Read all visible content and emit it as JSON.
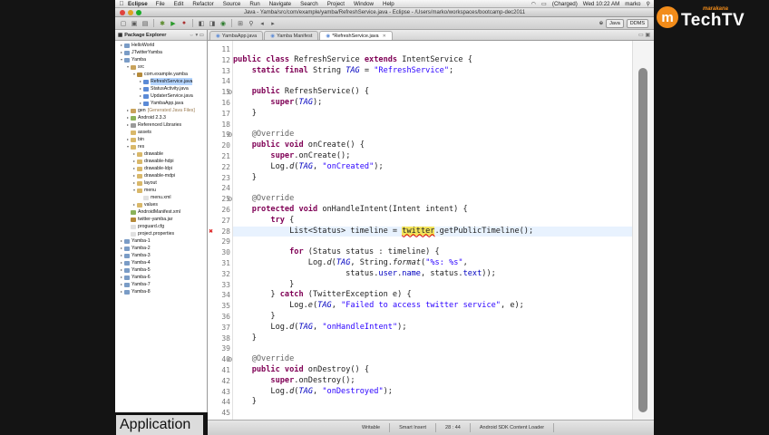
{
  "menubar": {
    "app": "Eclipse",
    "items": [
      "File",
      "Edit",
      "Refactor",
      "Source",
      "Run",
      "Navigate",
      "Search",
      "Project",
      "Window",
      "Help"
    ],
    "battery": "(Charged)",
    "clock": "Wed 10:22 AM",
    "user": "marko"
  },
  "window": {
    "title": "Java - Yamba/src/com/example/yamba/RefreshService.java - Eclipse - /Users/marko/workspaces/bootcamp-dec2011"
  },
  "toolbar": {
    "perspectives": [
      "Java",
      "DDMS"
    ]
  },
  "explorer": {
    "title": "Package Explorer",
    "nodes": [
      {
        "label": "HelloWorld",
        "depth": 0,
        "twisty": "▸",
        "color": "#7a9cc6"
      },
      {
        "label": "JTwitterYamba",
        "depth": 0,
        "twisty": "▸",
        "color": "#7a9cc6"
      },
      {
        "label": "Yamba",
        "depth": 0,
        "twisty": "▾",
        "color": "#7a9cc6"
      },
      {
        "label": "src",
        "depth": 1,
        "twisty": "▾",
        "color": "#c9a35c"
      },
      {
        "label": "com.example.yamba",
        "depth": 2,
        "twisty": "▾",
        "color": "#b58a3a"
      },
      {
        "label": "RefreshService.java",
        "depth": 3,
        "twisty": "▸",
        "color": "#5b8ad6",
        "selected": true
      },
      {
        "label": "StatusActivity.java",
        "depth": 3,
        "twisty": "▸",
        "color": "#5b8ad6"
      },
      {
        "label": "UpdaterService.java",
        "depth": 3,
        "twisty": "▸",
        "color": "#5b8ad6"
      },
      {
        "label": "YambaApp.java",
        "depth": 3,
        "twisty": "▸",
        "color": "#5b8ad6"
      },
      {
        "label": "gen",
        "depth": 1,
        "twisty": "▸",
        "color": "#c9a35c",
        "suffix": "[Generated Java Files]"
      },
      {
        "label": "Android 2.3.3",
        "depth": 1,
        "twisty": "▸",
        "color": "#8bb35a"
      },
      {
        "label": "Referenced Libraries",
        "depth": 1,
        "twisty": "▸",
        "color": "#9a9a9a"
      },
      {
        "label": "assets",
        "depth": 1,
        "twisty": "",
        "color": "#d9b86a"
      },
      {
        "label": "bin",
        "depth": 1,
        "twisty": "▸",
        "color": "#d9b86a"
      },
      {
        "label": "res",
        "depth": 1,
        "twisty": "▾",
        "color": "#d9b86a"
      },
      {
        "label": "drawable",
        "depth": 2,
        "twisty": "▸",
        "color": "#d9b86a"
      },
      {
        "label": "drawable-hdpi",
        "depth": 2,
        "twisty": "▸",
        "color": "#d9b86a"
      },
      {
        "label": "drawable-ldpi",
        "depth": 2,
        "twisty": "▸",
        "color": "#d9b86a"
      },
      {
        "label": "drawable-mdpi",
        "depth": 2,
        "twisty": "▸",
        "color": "#d9b86a"
      },
      {
        "label": "layout",
        "depth": 2,
        "twisty": "▸",
        "color": "#d9b86a"
      },
      {
        "label": "menu",
        "depth": 2,
        "twisty": "▾",
        "color": "#d9b86a"
      },
      {
        "label": "menu.xml",
        "depth": 3,
        "twisty": "",
        "color": "#e0e0e0"
      },
      {
        "label": "values",
        "depth": 2,
        "twisty": "▸",
        "color": "#d9b86a"
      },
      {
        "label": "AndroidManifest.xml",
        "depth": 1,
        "twisty": "",
        "color": "#8bb35a"
      },
      {
        "label": "twitter-yamba.jar",
        "depth": 1,
        "twisty": "",
        "color": "#b58a3a"
      },
      {
        "label": "proguard.cfg",
        "depth": 1,
        "twisty": "",
        "color": "#e0e0e0"
      },
      {
        "label": "project.properties",
        "depth": 1,
        "twisty": "",
        "color": "#e0e0e0"
      },
      {
        "label": "Yamba-1",
        "depth": 0,
        "twisty": "▸",
        "color": "#7a9cc6"
      },
      {
        "label": "Yamba-2",
        "depth": 0,
        "twisty": "▸",
        "color": "#7a9cc6"
      },
      {
        "label": "Yamba-3",
        "depth": 0,
        "twisty": "▸",
        "color": "#7a9cc6"
      },
      {
        "label": "Yamba-4",
        "depth": 0,
        "twisty": "▸",
        "color": "#7a9cc6"
      },
      {
        "label": "Yamba-5",
        "depth": 0,
        "twisty": "▸",
        "color": "#7a9cc6"
      },
      {
        "label": "Yamba-6",
        "depth": 0,
        "twisty": "▸",
        "color": "#7a9cc6"
      },
      {
        "label": "Yamba-7",
        "depth": 0,
        "twisty": "▸",
        "color": "#7a9cc6"
      },
      {
        "label": "Yamba-8",
        "depth": 0,
        "twisty": "▸",
        "color": "#7a9cc6"
      }
    ]
  },
  "tabs": [
    {
      "label": "YambaApp.java",
      "active": false
    },
    {
      "label": "Yamba Manifest",
      "active": false
    },
    {
      "label": "*RefreshService.java",
      "active": true
    }
  ],
  "editor": {
    "current_line": 28,
    "lines": [
      {
        "n": 11,
        "segs": []
      },
      {
        "n": 12,
        "segs": [
          [
            "kw",
            "public class "
          ],
          [
            "",
            "RefreshService "
          ],
          [
            "kw",
            "extends "
          ],
          [
            "",
            "IntentService {"
          ]
        ]
      },
      {
        "n": 13,
        "segs": [
          [
            "",
            "    "
          ],
          [
            "kw",
            "static final "
          ],
          [
            "",
            "String "
          ],
          [
            "fld",
            "TAG"
          ],
          [
            "",
            " = "
          ],
          [
            "str",
            "\"RefreshService\""
          ],
          [
            "",
            ";"
          ]
        ]
      },
      {
        "n": 14,
        "segs": []
      },
      {
        "n": 15,
        "fold": true,
        "segs": [
          [
            "",
            "    "
          ],
          [
            "kw",
            "public "
          ],
          [
            "",
            "RefreshService() {"
          ]
        ]
      },
      {
        "n": 16,
        "segs": [
          [
            "",
            "        "
          ],
          [
            "kw",
            "super"
          ],
          [
            "",
            "("
          ],
          [
            "fld",
            "TAG"
          ],
          [
            "",
            ");"
          ]
        ]
      },
      {
        "n": 17,
        "segs": [
          [
            "",
            "    }"
          ]
        ]
      },
      {
        "n": 18,
        "segs": []
      },
      {
        "n": 19,
        "fold": true,
        "segs": [
          [
            "",
            "    "
          ],
          [
            "ann",
            "@Override"
          ]
        ]
      },
      {
        "n": 20,
        "segs": [
          [
            "",
            "    "
          ],
          [
            "kw",
            "public void "
          ],
          [
            "",
            "onCreate() {"
          ]
        ]
      },
      {
        "n": 21,
        "segs": [
          [
            "",
            "        "
          ],
          [
            "kw",
            "super"
          ],
          [
            "",
            ".onCreate();"
          ]
        ]
      },
      {
        "n": 22,
        "segs": [
          [
            "",
            "        Log."
          ],
          [
            "ital",
            "d"
          ],
          [
            "",
            "("
          ],
          [
            "fld",
            "TAG"
          ],
          [
            "",
            ", "
          ],
          [
            "str",
            "\"onCreated\""
          ],
          [
            "",
            ");"
          ]
        ]
      },
      {
        "n": 23,
        "segs": [
          [
            "",
            "    }"
          ]
        ]
      },
      {
        "n": 24,
        "segs": []
      },
      {
        "n": 25,
        "fold": true,
        "segs": [
          [
            "",
            "    "
          ],
          [
            "ann",
            "@Override"
          ]
        ]
      },
      {
        "n": 26,
        "segs": [
          [
            "",
            "    "
          ],
          [
            "kw",
            "protected void "
          ],
          [
            "",
            "onHandleIntent(Intent intent) {"
          ]
        ]
      },
      {
        "n": 27,
        "segs": [
          [
            "",
            "        "
          ],
          [
            "kw",
            "try "
          ],
          [
            "",
            "{"
          ]
        ]
      },
      {
        "n": 28,
        "segs": [
          [
            "",
            "            List<Status> timeline = "
          ],
          [
            "hl",
            "twitter"
          ],
          [
            "",
            ".getPublicTimeline();"
          ]
        ]
      },
      {
        "n": 29,
        "segs": []
      },
      {
        "n": 30,
        "segs": [
          [
            "",
            "            "
          ],
          [
            "kw",
            "for "
          ],
          [
            "",
            "(Status status : timeline) {"
          ]
        ]
      },
      {
        "n": 31,
        "segs": [
          [
            "",
            "                Log."
          ],
          [
            "ital",
            "d"
          ],
          [
            "",
            "("
          ],
          [
            "fld",
            "TAG"
          ],
          [
            "",
            ", String."
          ],
          [
            "ital",
            "format"
          ],
          [
            "",
            "("
          ],
          [
            "str",
            "\"%s: %s\""
          ],
          [
            "",
            ","
          ]
        ]
      },
      {
        "n": 32,
        "segs": [
          [
            "",
            "                        status."
          ],
          [
            "mem",
            "user"
          ],
          [
            "",
            "."
          ],
          [
            "mem",
            "name"
          ],
          [
            "",
            ", status."
          ],
          [
            "mem",
            "text"
          ],
          [
            "",
            "));"
          ]
        ]
      },
      {
        "n": 33,
        "segs": [
          [
            "",
            "            }"
          ]
        ]
      },
      {
        "n": 34,
        "segs": [
          [
            "",
            "        } "
          ],
          [
            "kw",
            "catch "
          ],
          [
            "",
            "(TwitterException e) {"
          ]
        ]
      },
      {
        "n": 35,
        "segs": [
          [
            "",
            "            Log."
          ],
          [
            "ital",
            "e"
          ],
          [
            "",
            "("
          ],
          [
            "fld",
            "TAG"
          ],
          [
            "",
            ", "
          ],
          [
            "str",
            "\"Failed to access twitter service\""
          ],
          [
            "",
            ", e);"
          ]
        ]
      },
      {
        "n": 36,
        "segs": [
          [
            "",
            "        }"
          ]
        ]
      },
      {
        "n": 37,
        "segs": [
          [
            "",
            "        Log."
          ],
          [
            "ital",
            "d"
          ],
          [
            "",
            "("
          ],
          [
            "fld",
            "TAG"
          ],
          [
            "",
            ", "
          ],
          [
            "str",
            "\"onHandleIntent\""
          ],
          [
            "",
            ");"
          ]
        ]
      },
      {
        "n": 38,
        "segs": [
          [
            "",
            "    }"
          ]
        ]
      },
      {
        "n": 39,
        "segs": []
      },
      {
        "n": 40,
        "fold": true,
        "segs": [
          [
            "",
            "    "
          ],
          [
            "ann",
            "@Override"
          ]
        ]
      },
      {
        "n": 41,
        "segs": [
          [
            "",
            "    "
          ],
          [
            "kw",
            "public void "
          ],
          [
            "",
            "onDestroy() {"
          ]
        ]
      },
      {
        "n": 42,
        "segs": [
          [
            "",
            "        "
          ],
          [
            "kw",
            "super"
          ],
          [
            "",
            ".onDestroy();"
          ]
        ]
      },
      {
        "n": 43,
        "segs": [
          [
            "",
            "        Log."
          ],
          [
            "ital",
            "d"
          ],
          [
            "",
            "("
          ],
          [
            "fld",
            "TAG"
          ],
          [
            "",
            ", "
          ],
          [
            "str",
            "\"onDestroyed\""
          ],
          [
            "",
            ");"
          ]
        ]
      },
      {
        "n": 44,
        "segs": [
          [
            "",
            "    }"
          ]
        ]
      },
      {
        "n": 45,
        "segs": []
      }
    ]
  },
  "status": {
    "mode": "Writable",
    "insert": "Smart Insert",
    "position": "28 : 44",
    "task": "Android SDK Content Loader"
  },
  "caption": "Application",
  "logo": {
    "mark": "m",
    "small": "marakana",
    "big": "TechTV"
  },
  "colors": {
    "logo_orange": "#f28c1a",
    "selection": "#b5d5ff",
    "occurrence_highlight": "#f2e35a",
    "keyword": "#7f0055",
    "string": "#2a00ff"
  }
}
